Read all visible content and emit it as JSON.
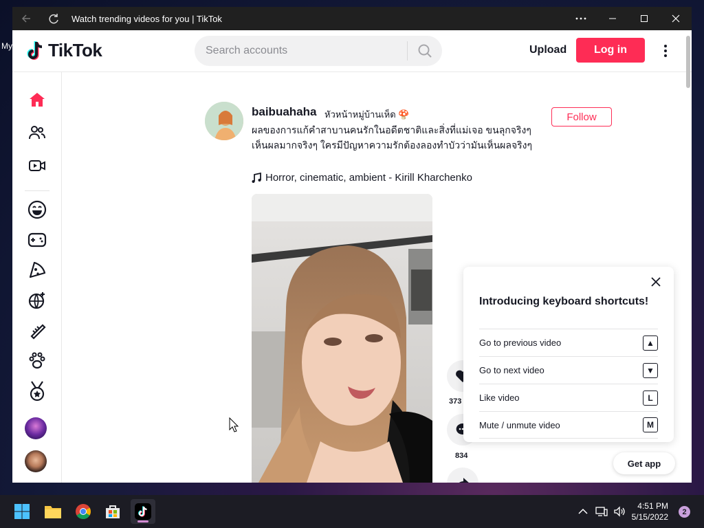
{
  "desktop": {
    "label": "My"
  },
  "window": {
    "title": "Watch trending videos for you | TikTok"
  },
  "header": {
    "logo_text": "TikTok",
    "search_placeholder": "Search accounts",
    "upload_label": "Upload",
    "login_label": "Log in"
  },
  "sidebar": {
    "items": [
      {
        "icon": "home-icon"
      },
      {
        "icon": "following-icon"
      },
      {
        "icon": "live-icon"
      },
      {
        "icon": "comedy-icon"
      },
      {
        "icon": "gaming-icon"
      },
      {
        "icon": "food-icon"
      },
      {
        "icon": "dance-icon"
      },
      {
        "icon": "beauty-icon"
      },
      {
        "icon": "animals-icon"
      },
      {
        "icon": "sports-icon"
      }
    ]
  },
  "post": {
    "username": "baibuahaha",
    "nickname": "หัวหน้าหมู่บ้านเห็ด 🍄",
    "follow_label": "Follow",
    "caption": "ผลของการแก้คำสาบานคนรักในอดีตชาติและสิ่งที่แม่เจอ ขนลุกจริงๆ เห็นผลมากจริงๆ ใครมีปัญหาความรักต้องลองทำบัวว่ามันเห็นผลจริงๆ",
    "music": "Horror, cinematic, ambient - Kirill Kharchenko",
    "likes": "373",
    "comments": "834"
  },
  "shortcuts_popup": {
    "title": "Introducing keyboard shortcuts!",
    "rows": [
      {
        "label": "Go to previous video",
        "key": "▲"
      },
      {
        "label": "Go to next video",
        "key": "▼"
      },
      {
        "label": "Like video",
        "key": "L"
      },
      {
        "label": "Mute / unmute video",
        "key": "M"
      }
    ]
  },
  "get_app_label": "Get app",
  "taskbar": {
    "time": "4:51 PM",
    "date": "5/15/2022",
    "notification_count": "2"
  },
  "colors": {
    "brand": "#fe2c55",
    "text": "#161823"
  }
}
